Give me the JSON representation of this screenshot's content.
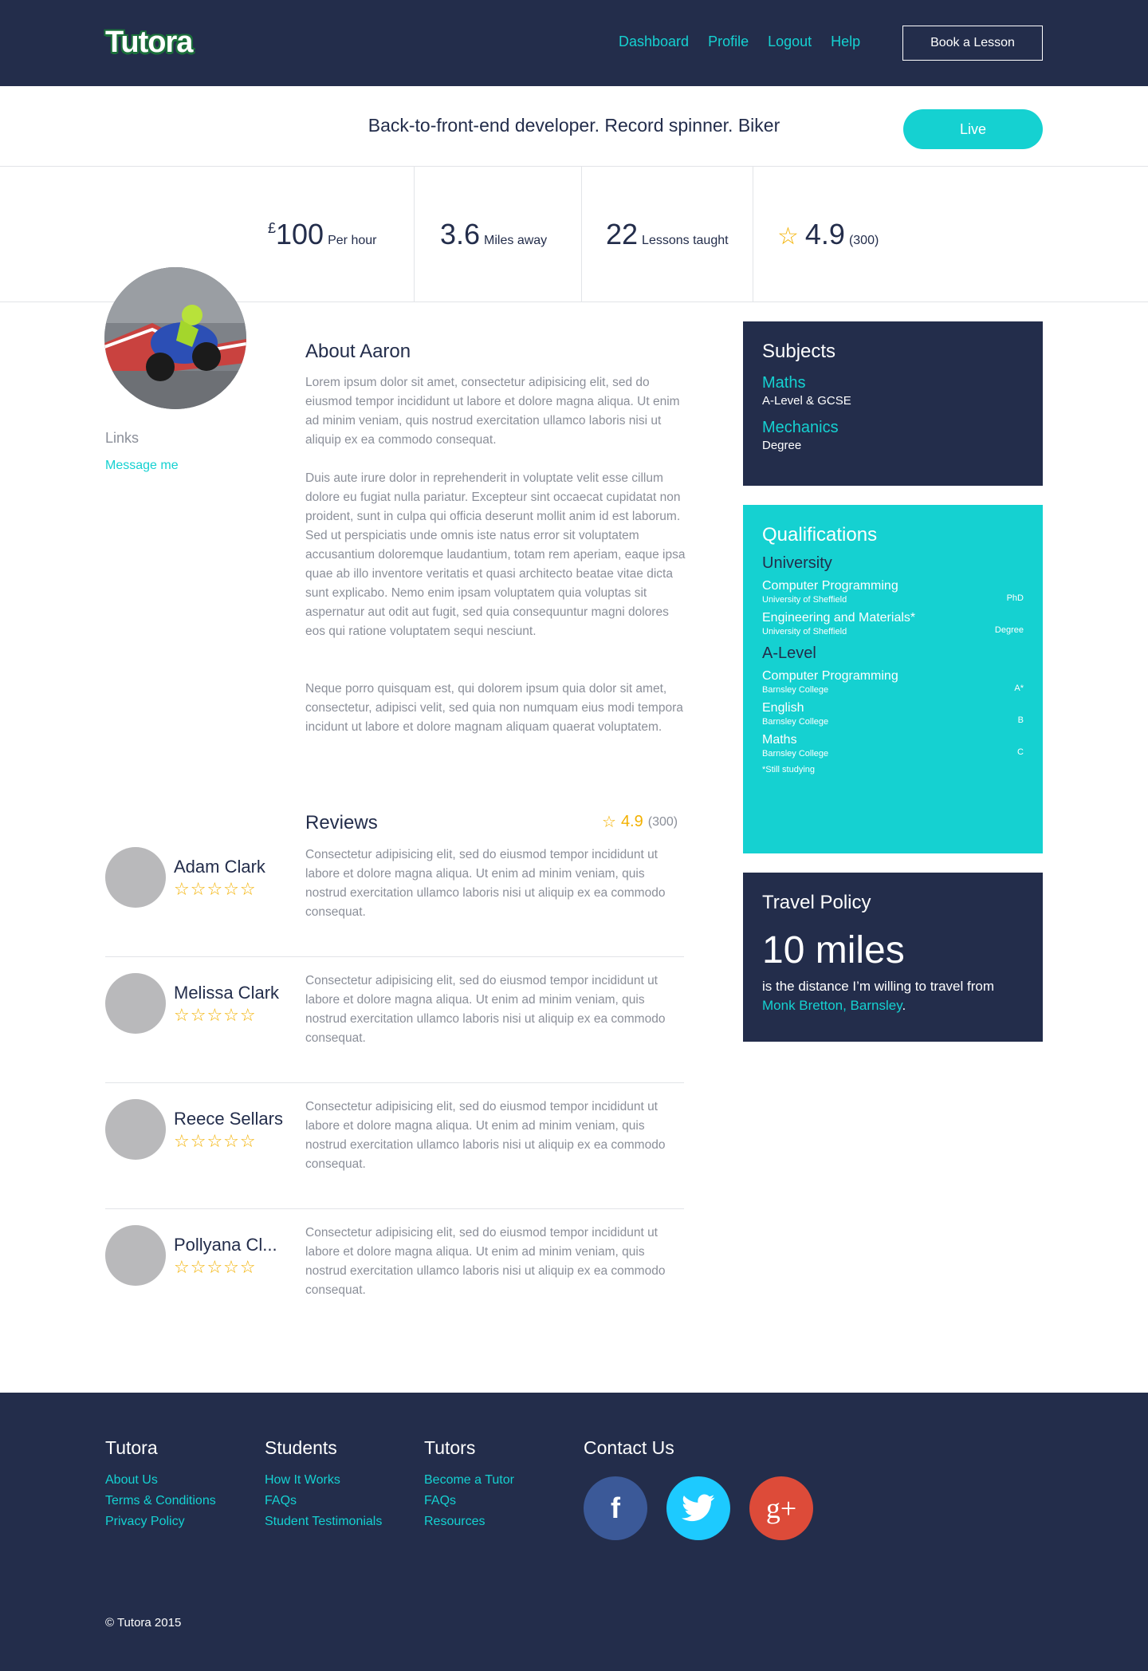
{
  "header": {
    "logo": "Tutora",
    "nav": [
      "Dashboard",
      "Profile",
      "Logout",
      "Help"
    ],
    "book_button": "Book a Lesson"
  },
  "tagline": {
    "text": "Back-to-front-end developer. Record spinner. Biker",
    "live_button": "Live"
  },
  "stats": {
    "price_currency": "£",
    "price_value": "100",
    "price_label": "Per hour",
    "distance_value": "3.6",
    "distance_label": "Miles away",
    "lessons_value": "22",
    "lessons_label": "Lessons taught",
    "rating_value": "4.9",
    "rating_count": "(300)"
  },
  "profile": {
    "links_title": "Links",
    "message_link": "Message me"
  },
  "about": {
    "title": "About Aaron",
    "paragraphs": [
      "Lorem ipsum dolor sit amet, consectetur adipisicing elit, sed do eiusmod tempor incididunt ut labore et dolore magna aliqua. Ut enim ad minim veniam, quis nostrud exercitation ullamco laboris nisi ut aliquip ex ea commodo consequat.",
      "Duis aute irure dolor in reprehenderit in voluptate velit esse cillum dolore eu fugiat nulla pariatur. Excepteur sint occaecat cupidatat non proident, sunt in culpa qui officia deserunt mollit anim id est laborum. Sed ut perspiciatis unde omnis iste natus error sit voluptatem accusantium doloremque laudantium, totam rem aperiam, eaque ipsa quae ab illo inventore veritatis et quasi architecto beatae vitae dicta sunt explicabo. Nemo enim ipsam voluptatem quia voluptas sit aspernatur aut odit aut fugit, sed quia consequuntur magni dolores eos qui ratione voluptatem sequi nesciunt.",
      "Neque porro quisquam est, qui dolorem ipsum quia dolor sit amet, consectetur, adipisci velit, sed quia non numquam eius modi tempora incidunt ut labore et dolore magnam aliquam quaerat voluptatem."
    ]
  },
  "reviews": {
    "title": "Reviews",
    "rating": "4.9",
    "count": "(300)",
    "stars": "☆☆☆☆☆",
    "items": [
      {
        "name": "Adam Clark",
        "text": "Consectetur adipisicing elit, sed do eiusmod tempor incididunt ut labore et dolore magna aliqua. Ut enim ad minim veniam, quis nostrud exercitation ullamco laboris nisi ut aliquip ex ea commodo consequat."
      },
      {
        "name": "Melissa Clark",
        "text": "Consectetur adipisicing elit, sed do eiusmod tempor incididunt ut labore et dolore magna aliqua. Ut enim ad minim veniam, quis nostrud exercitation ullamco laboris nisi ut aliquip ex ea commodo consequat."
      },
      {
        "name": "Reece Sellars",
        "text": "Consectetur adipisicing elit, sed do eiusmod tempor incididunt ut labore et dolore magna aliqua. Ut enim ad minim veniam, quis nostrud exercitation ullamco laboris nisi ut aliquip ex ea commodo consequat."
      },
      {
        "name": "Pollyana Cl...",
        "text": "Consectetur adipisicing elit, sed do eiusmod tempor incididunt ut labore et dolore magna aliqua. Ut enim ad minim veniam, quis nostrud exercitation ullamco laboris nisi ut aliquip ex ea commodo consequat."
      }
    ]
  },
  "subjects": {
    "title": "Subjects",
    "items": [
      {
        "name": "Maths",
        "level": "A-Level & GCSE"
      },
      {
        "name": "Mechanics",
        "level": "Degree"
      }
    ]
  },
  "qualifications": {
    "title": "Qualifications",
    "university_title": "University",
    "university": [
      {
        "name": "Computer Programming",
        "institution": "University of Sheffield",
        "grade": "PhD"
      },
      {
        "name": "Engineering and Materials*",
        "institution": "University of Sheffield",
        "grade": "Degree"
      }
    ],
    "alevel_title": "A-Level",
    "alevel": [
      {
        "name": "Computer Programming",
        "institution": "Barnsley College",
        "grade": "A*"
      },
      {
        "name": "English",
        "institution": "Barnsley College",
        "grade": "B"
      },
      {
        "name": "Maths",
        "institution": "Barnsley College",
        "grade": "C"
      }
    ],
    "note": "*Still studying"
  },
  "travel": {
    "title": "Travel Policy",
    "distance": "10 miles",
    "text": "is the distance I’m willing to travel from",
    "location": "Monk Bretton, Barnsley",
    "period": "."
  },
  "footer": {
    "tutora": {
      "title": "Tutora",
      "links": [
        "About Us",
        "Terms & Conditions",
        "Privacy Policy"
      ]
    },
    "students": {
      "title": "Students",
      "links": [
        "How It Works",
        "FAQs",
        "Student Testimonials"
      ]
    },
    "tutors": {
      "title": "Tutors",
      "links": [
        "Become a Tutor",
        "FAQs",
        "Resources"
      ]
    },
    "contact_title": "Contact Us",
    "social": {
      "facebook": "f",
      "google": "g+"
    },
    "copyright": "© Tutora 2015"
  },
  "colors": {
    "navy": "#232d4b",
    "cyan": "#15d1d1",
    "star": "#f3b100",
    "facebook": "#3b5998",
    "twitter": "#1dcaff",
    "google": "#dd4b39"
  }
}
